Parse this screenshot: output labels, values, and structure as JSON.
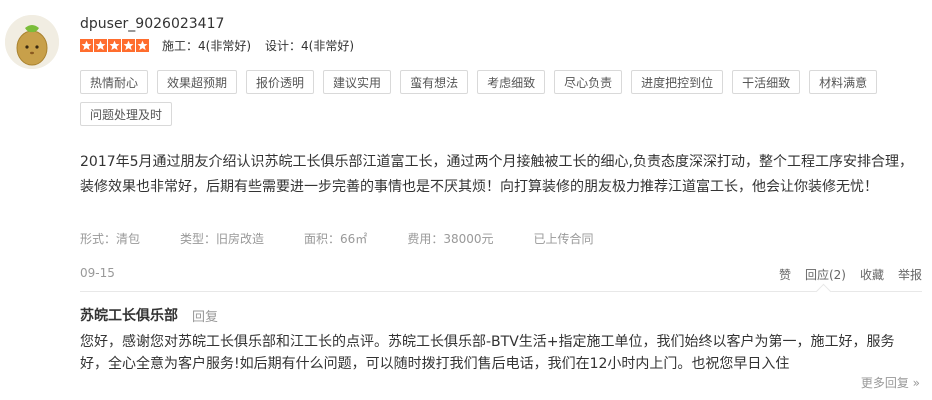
{
  "user": {
    "name": "dpuser_9026023417"
  },
  "rating": {
    "stars": 5,
    "star_color": "#ff6d2e",
    "items": [
      {
        "label": "施工：4(非常好)"
      },
      {
        "label": "设计：4(非常好)"
      }
    ]
  },
  "tags": [
    "热情耐心",
    "效果超预期",
    "报价透明",
    "建议实用",
    "蛮有想法",
    "考虑细致",
    "尽心负责",
    "进度把控到位",
    "干活细致",
    "材料满意",
    "问题处理及时"
  ],
  "review": {
    "text": "2017年5月通过朋友介绍认识苏皖工长俱乐部江道富工长，通过两个月接触被工长的细心,负责态度深深打动，整个工程工序安排合理，装修效果也非常好，后期有些需要进一步完善的事情也是不厌其烦！向打算装修的朋友极力推荐江道富工长，他会让你装修无忧！"
  },
  "meta": {
    "form": "形式：清包",
    "type": "类型：旧房改造",
    "area": "面积：66㎡",
    "cost": "费用：38000元",
    "contract": "已上传合同"
  },
  "date": "09-15",
  "actions": {
    "like": "赞",
    "reply": "回应(2)",
    "favorite": "收藏",
    "report": "举报"
  },
  "reply": {
    "author": "苏皖工长俱乐部",
    "reply_label": "回复",
    "text": "您好，感谢您对苏皖工长俱乐部和江工长的点评。苏皖工长俱乐部-BTV生活+指定施工单位，我们始终以客户为第一，施工好，服务好，全心全意为客户服务!如后期有什么问题，可以随时拨打我们售后电话，我们在12小时内上门。也祝您早日入住"
  },
  "more_replies": "更多回复 »"
}
